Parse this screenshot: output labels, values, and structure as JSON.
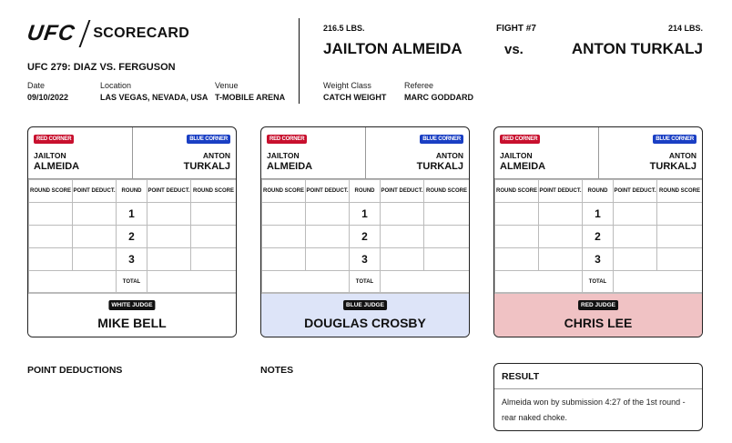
{
  "header": {
    "logo_text": "UFC",
    "subtitle": "SCORECARD",
    "event": "UFC 279: DIAZ VS. FERGUSON",
    "date_label": "Date",
    "date": "09/10/2022",
    "location_label": "Location",
    "location": "LAS VEGAS, NEVADA, USA",
    "venue_label": "Venue",
    "venue": "T-MOBILE ARENA",
    "weight_class_label": "Weight Class",
    "weight_class": "CATCH WEIGHT",
    "referee_label": "Referee",
    "referee": "MARC GODDARD"
  },
  "fight": {
    "red_weight": "216.5 LBS.",
    "red_name": "JAILTON ALMEIDA",
    "fight_number": "FIGHT #7",
    "vs": "vs.",
    "blue_weight": "214 LBS.",
    "blue_name": "ANTON TURKALJ"
  },
  "table_headers": {
    "round_score": "ROUND SCORE",
    "point_deduct": "POINT DEDUCT.",
    "round": "ROUND",
    "total": "TOTAL"
  },
  "cards": [
    {
      "red_badge": "RED CORNER",
      "blue_badge": "BLUE CORNER",
      "red_first": "JAILTON",
      "red_last": "ALMEIDA",
      "blue_first": "ANTON",
      "blue_last": "TURKALJ",
      "rounds": [
        "1",
        "2",
        "3"
      ],
      "judge_tag": "WHITE JUDGE",
      "judge_name": "MIKE BELL",
      "judge_bg": "#ffffff"
    },
    {
      "red_badge": "RED CORNER",
      "blue_badge": "BLUE CORNER",
      "red_first": "JAILTON",
      "red_last": "ALMEIDA",
      "blue_first": "ANTON",
      "blue_last": "TURKALJ",
      "rounds": [
        "1",
        "2",
        "3"
      ],
      "judge_tag": "BLUE JUDGE",
      "judge_name": "DOUGLAS CROSBY",
      "judge_bg": "#dde4f8"
    },
    {
      "red_badge": "RED CORNER",
      "blue_badge": "BLUE CORNER",
      "red_first": "JAILTON",
      "red_last": "ALMEIDA",
      "blue_first": "ANTON",
      "blue_last": "TURKALJ",
      "rounds": [
        "1",
        "2",
        "3"
      ],
      "judge_tag": "RED JUDGE",
      "judge_name": "CHRIS LEE",
      "judge_bg": "#f0c2c4"
    }
  ],
  "footer": {
    "point_deductions": "POINT DEDUCTIONS",
    "notes": "NOTES",
    "result_title": "RESULT",
    "result_text": "Almeida won by submission 4:27 of the 1st round - rear naked choke."
  }
}
